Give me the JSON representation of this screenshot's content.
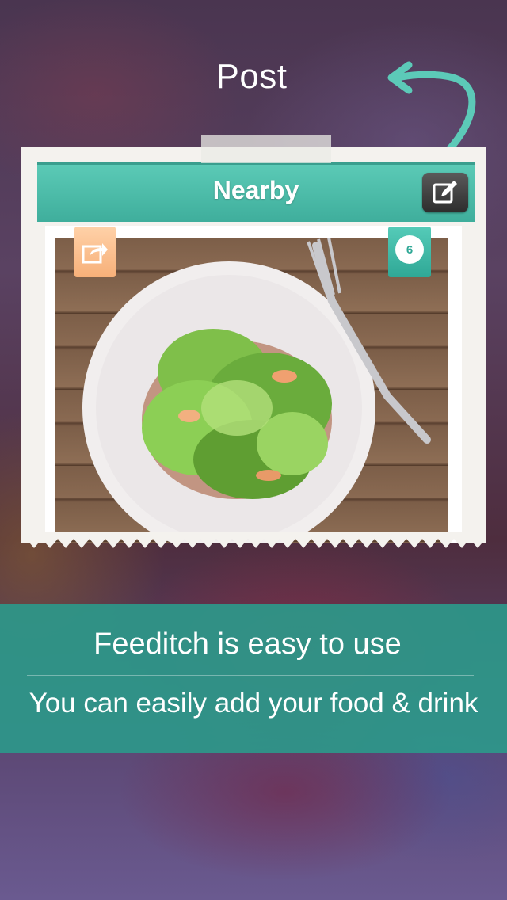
{
  "header": {
    "post_label": "Post"
  },
  "nav": {
    "title": "Nearby",
    "compose_icon": "compose-icon"
  },
  "photo": {
    "share_icon": "share-icon",
    "count": "6"
  },
  "banner": {
    "title": "Feeditch is easy to use",
    "subtitle": "You can easily add your food & drink"
  },
  "colors": {
    "accent": "#3fae9c",
    "share": "#f7b079",
    "banner": "#2c988a"
  }
}
